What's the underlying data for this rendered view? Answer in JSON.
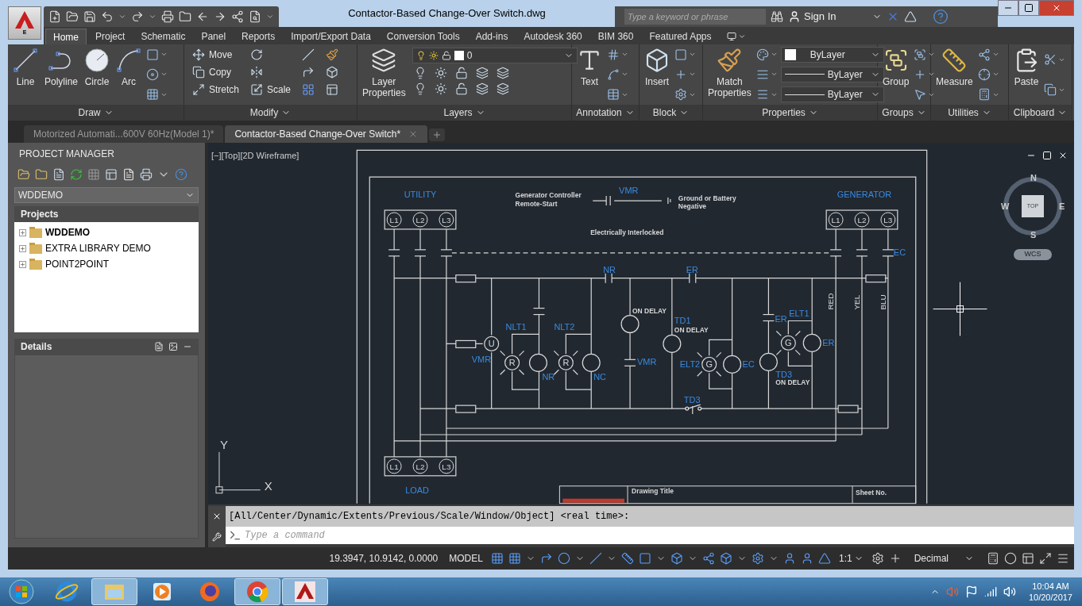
{
  "window": {
    "title": "Contactor-Based Change-Over Switch.dwg"
  },
  "app_button": {
    "badge": "E"
  },
  "search": {
    "placeholder": "Type a keyword or phrase"
  },
  "sign_in": {
    "label": "Sign In"
  },
  "ribbon_tabs": [
    {
      "label": "Home",
      "selected": true
    },
    {
      "label": "Project",
      "selected": false
    },
    {
      "label": "Schematic",
      "selected": false
    },
    {
      "label": "Panel",
      "selected": false
    },
    {
      "label": "Reports",
      "selected": false
    },
    {
      "label": "Import/Export Data",
      "selected": false
    },
    {
      "label": "Conversion Tools",
      "selected": false
    },
    {
      "label": "Add-ins",
      "selected": false
    },
    {
      "label": "Autodesk 360",
      "selected": false
    },
    {
      "label": "BIM 360",
      "selected": false
    },
    {
      "label": "Featured Apps",
      "selected": false
    }
  ],
  "ribbon_panels": [
    {
      "title": "Draw",
      "tools": [
        {
          "label": "Line"
        },
        {
          "label": "Polyline"
        },
        {
          "label": "Circle"
        },
        {
          "label": "Arc"
        }
      ]
    },
    {
      "title": "Modify",
      "tools": [
        {
          "label": "Move"
        },
        {
          "label": "Copy"
        },
        {
          "label": "Stretch"
        },
        {
          "label": "Scale"
        }
      ]
    },
    {
      "title": "Layers",
      "tools": [
        {
          "label": "Layer Properties"
        }
      ],
      "layer_select": "0"
    },
    {
      "title": "Annotation",
      "tools": [
        {
          "label": "Text"
        }
      ]
    },
    {
      "title": "Block",
      "tools": [
        {
          "label": "Insert"
        }
      ]
    },
    {
      "title": "Properties",
      "tools": [
        {
          "label": "Match Properties"
        }
      ],
      "dropdowns": [
        {
          "value": "ByLayer",
          "kind": "color"
        },
        {
          "value": "ByLayer",
          "kind": "line"
        },
        {
          "value": "ByLayer",
          "kind": "line"
        }
      ]
    },
    {
      "title": "Groups",
      "tools": [
        {
          "label": "Group"
        }
      ]
    },
    {
      "title": "Utilities",
      "tools": [
        {
          "label": "Measure"
        }
      ]
    },
    {
      "title": "Clipboard",
      "tools": [
        {
          "label": "Paste"
        }
      ]
    }
  ],
  "doc_tabs": [
    {
      "label": "Motorized Automati...600V 60Hz(Model 1)*",
      "selected": false
    },
    {
      "label": "Contactor-Based Change-Over Switch*",
      "selected": true
    }
  ],
  "project_manager": {
    "title": "PROJECT MANAGER",
    "project_select": "WDDEMO",
    "projects_header": "Projects",
    "projects": [
      {
        "label": "WDDEMO",
        "active": true
      },
      {
        "label": "EXTRA LIBRARY DEMO",
        "active": false
      },
      {
        "label": "POINT2POINT",
        "active": false
      }
    ],
    "details_header": "Details"
  },
  "viewport": {
    "label": "[−][Top][2D Wireframe]",
    "viewcube": {
      "top": "TOP",
      "north": "N",
      "south": "S",
      "east": "E",
      "west": "W",
      "wcs": "WCS"
    },
    "ucs": {
      "x": "X",
      "y": "Y"
    },
    "terminal_blocks": [
      {
        "title": "UTILITY",
        "terminals": [
          "L1",
          "L2",
          "L3"
        ]
      },
      {
        "title": "GENERATOR",
        "terminals": [
          "L1",
          "L2",
          "L3"
        ]
      },
      {
        "title": "LOAD",
        "terminals": [
          "L1",
          "L2",
          "L3"
        ]
      }
    ],
    "labels": [
      {
        "text": "Generator Controller",
        "kind": "note"
      },
      {
        "text": "Remote-Start",
        "kind": "note"
      },
      {
        "text": "Ground or Battery",
        "kind": "note"
      },
      {
        "text": "Negative",
        "kind": "note"
      },
      {
        "text": "Electrically Interlocked",
        "kind": "note"
      },
      {
        "text": "ON DELAY",
        "kind": "note"
      },
      {
        "text": "ON DELAY",
        "kind": "note"
      },
      {
        "text": "ON DELAY",
        "kind": "note"
      },
      {
        "text": "Drawing Title",
        "kind": "note"
      },
      {
        "text": "Sheet No.",
        "kind": "note"
      },
      {
        "text": "RED",
        "kind": "wire"
      },
      {
        "text": "YEL",
        "kind": "wire"
      },
      {
        "text": "BLU",
        "kind": "wire"
      },
      {
        "text": "VMR",
        "kind": "tag"
      },
      {
        "text": "EC",
        "kind": "tag"
      },
      {
        "text": "NR",
        "kind": "tag"
      },
      {
        "text": "ER",
        "kind": "tag"
      },
      {
        "text": "NLT1",
        "kind": "tag"
      },
      {
        "text": "NLT2",
        "kind": "tag"
      },
      {
        "text": "VMR",
        "kind": "tag"
      },
      {
        "text": "NR",
        "kind": "tag"
      },
      {
        "text": "NC",
        "kind": "tag"
      },
      {
        "text": "TD1",
        "kind": "tag"
      },
      {
        "text": "ELT2",
        "kind": "tag"
      },
      {
        "text": "EC",
        "kind": "tag"
      },
      {
        "text": "ELT1",
        "kind": "tag"
      },
      {
        "text": "ER",
        "kind": "tag"
      },
      {
        "text": "ER",
        "kind": "tag"
      },
      {
        "text": "TD3",
        "kind": "tag"
      },
      {
        "text": "TD3",
        "kind": "tag"
      },
      {
        "text": "VMR",
        "kind": "tag"
      },
      {
        "text": "U",
        "kind": "symbol"
      },
      {
        "text": "R",
        "kind": "symbol"
      },
      {
        "text": "R",
        "kind": "symbol"
      },
      {
        "text": "G",
        "kind": "symbol"
      },
      {
        "text": "G",
        "kind": "symbol"
      }
    ]
  },
  "command_line": {
    "history": "[All/Center/Dynamic/Extents/Previous/Scale/Window/Object] <real time>:",
    "placeholder": "Type a command"
  },
  "status_bar": {
    "coordinates": "19.3947, 10.9142, 0.0000",
    "space": "MODEL",
    "scale": "1:1",
    "units": "Decimal"
  },
  "taskbar": {
    "apps": [
      {
        "running": false
      },
      {
        "running": true
      },
      {
        "running": false
      },
      {
        "running": false
      },
      {
        "running": true
      },
      {
        "running": true
      }
    ],
    "time": "10:04 AM",
    "date": "10/20/2017"
  }
}
